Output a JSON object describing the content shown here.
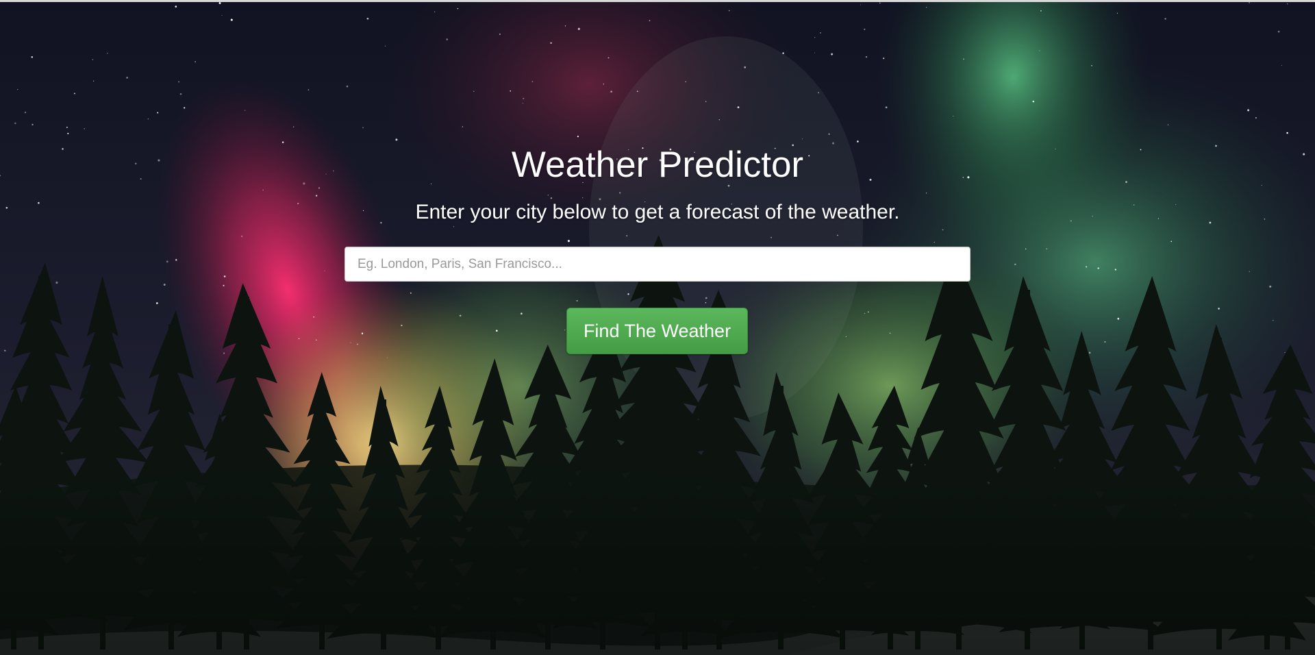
{
  "page": {
    "title": "Weather Predictor",
    "subtitle": "Enter your city below to get a forecast of the weather."
  },
  "search": {
    "placeholder": "Eg. London, Paris, San Francisco...",
    "value": ""
  },
  "actions": {
    "find_label": "Find The Weather"
  },
  "background": {
    "scene": "aurora-over-pine-forest",
    "sky_color": "#15172a",
    "aurora_red": "#ff2a6a",
    "aurora_yellow": "#f5d26a",
    "aurora_green": "#3f9a64",
    "tree_color": "#0d140f",
    "snow_color": "#c9d3dc"
  },
  "colors": {
    "button_green": "#5cb85c",
    "text": "#ffffff"
  }
}
